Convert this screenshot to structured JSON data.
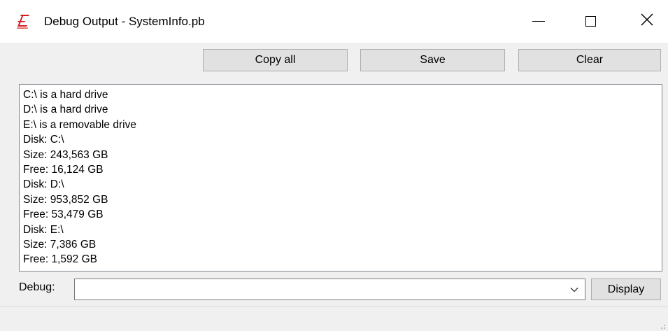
{
  "window": {
    "title": "Debug Output - SystemInfo.pb",
    "app_icon": "purebasic-icon",
    "controls": [
      "minimize-icon",
      "maximize-icon",
      "close-icon"
    ]
  },
  "toolbar": {
    "copy_all_label": "Copy all",
    "save_label": "Save",
    "clear_label": "Clear"
  },
  "output": {
    "lines": [
      "C:\\ is a hard drive",
      "D:\\ is a hard drive",
      "E:\\ is a removable drive",
      "Disk: C:\\",
      "Size: 243,563 GB",
      "Free: 16,124 GB",
      "Disk: D:\\",
      "Size: 953,852 GB",
      "Free: 53,479 GB",
      "Disk: E:\\",
      "Size: 7,386 GB",
      "Free: 1,592 GB"
    ]
  },
  "debug": {
    "label": "Debug:",
    "value": "",
    "display_label": "Display"
  },
  "colors": {
    "app_icon": "#d41e1e",
    "button_bg": "#e1e1e1",
    "window_bg": "#f0f0f0"
  }
}
